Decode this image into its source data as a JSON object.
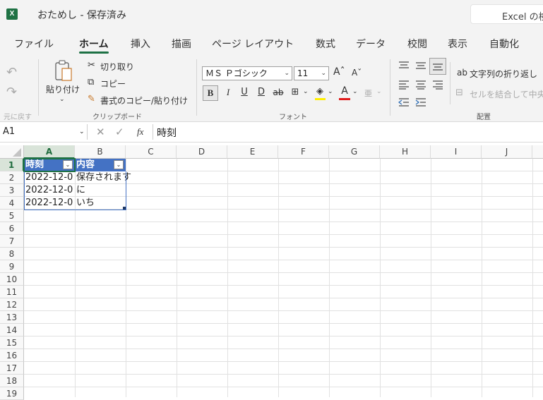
{
  "titlebar": {
    "app_icon": "excel-icon",
    "doc_title": "おためし - 保存済み",
    "search_text": "Excel の検"
  },
  "tabs": [
    "ファイル",
    "ホーム",
    "挿入",
    "描画",
    "ページ レイアウト",
    "数式",
    "データ",
    "校閲",
    "表示",
    "自動化"
  ],
  "active_tab": "ホーム",
  "accent_color": "#1e7145",
  "ribbon": {
    "undo_label": "元に戻す",
    "clipboard": {
      "paste": "貼り付け",
      "cut": "切り取り",
      "copy": "コピー",
      "format_painter": "書式のコピー/貼り付け",
      "group_label": "クリップボード"
    },
    "font": {
      "font_name": "ＭＳ Ｐゴシック",
      "font_size": "11",
      "bold": "B",
      "italic": "I",
      "underline": "U",
      "double_underline": "D",
      "strike": "ab",
      "group_label": "フォント"
    },
    "alignment": {
      "wrap_text": "文字列の折り返し",
      "merge_center": "セルを結合して中央",
      "group_label": "配置"
    }
  },
  "formula_bar": {
    "name_box": "A1",
    "fx": "fx",
    "content": "時刻"
  },
  "sheet": {
    "columns": [
      "A",
      "B",
      "C",
      "D",
      "E",
      "F",
      "G",
      "H",
      "I",
      "J"
    ],
    "rows": [
      "1",
      "2",
      "3",
      "4",
      "5",
      "6",
      "7",
      "8",
      "9",
      "10",
      "11",
      "12",
      "13",
      "14",
      "15",
      "16",
      "17",
      "18",
      "19"
    ],
    "table_header": [
      "時刻",
      "内容"
    ],
    "table_rows": [
      [
        "2022-12-0",
        "保存されます"
      ],
      [
        "2022-12-0",
        "に"
      ],
      [
        "2022-12-0",
        "いち"
      ]
    ],
    "header_color": "#4472c4"
  }
}
